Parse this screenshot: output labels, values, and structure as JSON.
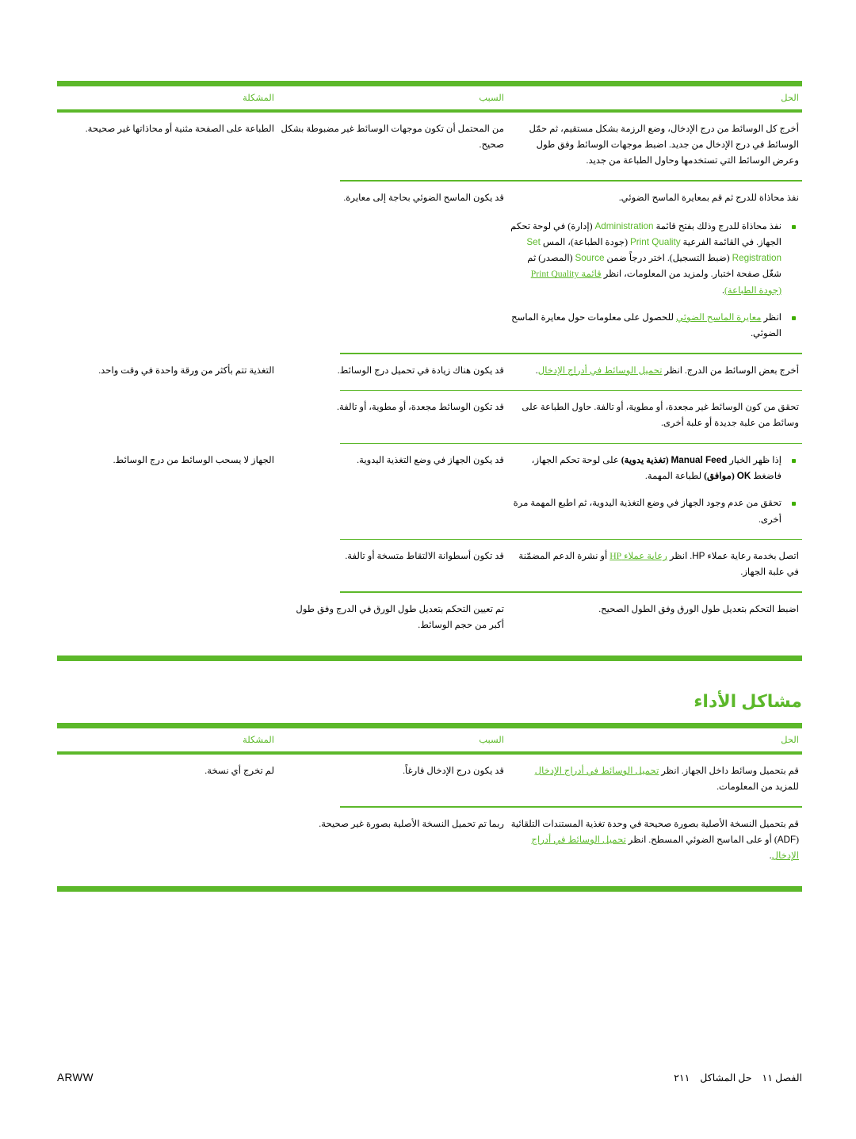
{
  "page": {
    "language": "ar",
    "direction": "rtl",
    "accent_color": "#5cb82a",
    "text_color": "#000000"
  },
  "table_one": {
    "headers": {
      "problem": "المشكلة",
      "cause": "السبب",
      "solution": "الحل"
    },
    "rows": [
      {
        "problem": "الطباعة على الصفحة مثنية أو محاذاتها غير صحيحة.",
        "cause": "من المحتمل أن تكون موجهات الوسائط غير مضبوطة بشكل صحيح.",
        "solution": "أخرج كل الوسائط من درج الإدخال، وضع الرزمة بشكل مستقيم، ثم حمّل الوسائط في درج الإدخال من جديد. اضبط موجهات الوسائط وفق طول وعرض الوسائط التي تستخدمها وحاول الطباعة من جديد."
      },
      {
        "problem": "",
        "cause": "قد يكون الماسح الضوئي بحاجة إلى معايرة.",
        "solution_plain": "نفذ محاذاة للدرج ثم قم بمعايرة الماسح الضوئي.",
        "solution_bullets": [
          {
            "parts": [
              {
                "t": "نفذ محاذاة للدرج وذلك بفتح قائمة ",
                "style": "normal"
              },
              {
                "t": "Administration",
                "style": "green-lat"
              },
              {
                "t": " (إدارة) في لوحة تحكم الجهاز. في القائمة الفرعية ",
                "style": "normal"
              },
              {
                "t": "Print Quality",
                "style": "green-lat"
              },
              {
                "t": " (جودة الطباعة)، المس ",
                "style": "normal"
              },
              {
                "t": "Set Registration",
                "style": "green-lat"
              },
              {
                "t": " (ضبط التسجيل). اختر درجاً ضمن ",
                "style": "normal"
              },
              {
                "t": "Source",
                "style": "green-lat"
              },
              {
                "t": " (المصدر) ثم شغّل صفحة اختبار. ولمزيد من المعلومات، انظر ",
                "style": "normal"
              },
              {
                "t": "قائمة Print Quality (جودة الطباعة)",
                "style": "green-link"
              },
              {
                "t": ".",
                "style": "normal"
              }
            ]
          },
          {
            "parts": [
              {
                "t": "انظر ",
                "style": "normal"
              },
              {
                "t": "معايرة الماسح الضوئي",
                "style": "green-link"
              },
              {
                "t": " للحصول على معلومات حول معايرة الماسح الضوئي.",
                "style": "normal"
              }
            ]
          }
        ]
      },
      {
        "problem": "التغذية تتم بأكثر من ورقة واحدة في وقت واحد.",
        "cause": "قد يكون هناك زيادة في تحميل درج الوسائط.",
        "solution_parts": [
          {
            "t": "أخرج بعض الوسائط من الدرج. انظر ",
            "style": "normal"
          },
          {
            "t": "تحميل الوسائط في أدراج الإدخال",
            "style": "green-link"
          },
          {
            "t": ".",
            "style": "normal"
          }
        ]
      },
      {
        "problem": "",
        "cause": "قد تكون الوسائط مجعدة، أو مطوية، أو تالفة.",
        "solution": "تحقق من كون الوسائط غير مجعدة، أو مطوية، أو تالفة. حاول الطباعة على وسائط من علبة جديدة أو علبة أخرى."
      },
      {
        "problem": "الجهاز لا يسحب الوسائط من درج الوسائط.",
        "cause": "قد يكون الجهاز في وضع التغذية اليدوية.",
        "solution_bullets": [
          {
            "parts": [
              {
                "t": "إذا ظهر الخيار ",
                "style": "normal"
              },
              {
                "t": "Manual Feed",
                "style": "bold-lat"
              },
              {
                "t": " (تغذية يدوية)",
                "style": "bold"
              },
              {
                "t": " على لوحة تحكم الجهاز، فاضغط ",
                "style": "normal"
              },
              {
                "t": "OK",
                "style": "bold-lat"
              },
              {
                "t": " (موافق)",
                "style": "bold"
              },
              {
                "t": " لطباعة المهمة.",
                "style": "normal"
              }
            ]
          },
          {
            "parts": [
              {
                "t": "تحقق من عدم وجود الجهاز في وضع التغذية اليدوية، ثم اطبع المهمة مرة أخرى.",
                "style": "normal"
              }
            ]
          }
        ]
      },
      {
        "problem": "",
        "cause": "قد تكون أسطوانة الالتقاط متسخة أو تالفة.",
        "solution_parts": [
          {
            "t": "اتصل بخدمة رعاية عملاء ",
            "style": "normal"
          },
          {
            "t": "HP",
            "style": "lat"
          },
          {
            "t": ". انظر ",
            "style": "normal"
          },
          {
            "t": "رعاية عملاء HP",
            "style": "green-link"
          },
          {
            "t": " أو نشرة الدعم المضمّنة في علبة الجهاز.",
            "style": "normal"
          }
        ]
      },
      {
        "problem": "",
        "cause": "تم تعيين التحكم بتعديل طول الورق في الدرج وفق طول أكبر من حجم الوسائط.",
        "solution": "اضبط التحكم بتعديل طول الورق وفق الطول الصحيح."
      }
    ]
  },
  "section_heading": "مشاكل الأداء",
  "table_two": {
    "headers": {
      "problem": "المشكلة",
      "cause": "السبب",
      "solution": "الحل"
    },
    "rows": [
      {
        "problem": "لم تخرج أي نسخة.",
        "cause": "قد يكون درج الإدخال فارغاً.",
        "solution_parts": [
          {
            "t": "قم بتحميل وسائط داخل الجهاز. انظر ",
            "style": "normal"
          },
          {
            "t": "تحميل الوسائط في أدراج الإدخال",
            "style": "green-link"
          },
          {
            "t": " للمزيد من المعلومات.",
            "style": "normal"
          }
        ]
      },
      {
        "problem": "",
        "cause": "ربما تم تحميل النسخة الأصلية بصورة غير صحيحة.",
        "solution_parts": [
          {
            "t": "قم بتحميل النسخة الأصلية بصورة صحيحة في وحدة تغذية المستندات التلقائية (",
            "style": "normal"
          },
          {
            "t": "ADF",
            "style": "lat"
          },
          {
            "t": ") أو على الماسح الضوئي المسطح. انظر ",
            "style": "normal"
          },
          {
            "t": "تحميل الوسائط في أدراج الإدخال",
            "style": "green-link"
          },
          {
            "t": ".",
            "style": "normal"
          }
        ]
      }
    ]
  },
  "footer": {
    "chapter_label": "الفصل ١١",
    "section_label": "حل المشاكل",
    "page_number": "٢١١",
    "doc_code": "ARWW"
  }
}
